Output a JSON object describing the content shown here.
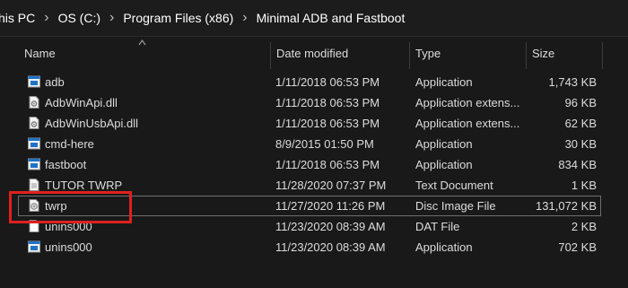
{
  "breadcrumb": [
    "his PC",
    "OS (C:)",
    "Program Files (x86)",
    "Minimal ADB and Fastboot"
  ],
  "columns": {
    "name": "Name",
    "date": "Date modified",
    "type": "Type",
    "size": "Size"
  },
  "files": [
    {
      "name": "adb",
      "date": "1/11/2018 06:53 PM",
      "type": "Application",
      "size": "1,743 KB",
      "icon": "application-icon"
    },
    {
      "name": "AdbWinApi.dll",
      "date": "1/11/2018 06:53 PM",
      "type": "Application extens...",
      "size": "96 KB",
      "icon": "dll-icon"
    },
    {
      "name": "AdbWinUsbApi.dll",
      "date": "1/11/2018 06:53 PM",
      "type": "Application extens...",
      "size": "62 KB",
      "icon": "dll-icon"
    },
    {
      "name": "cmd-here",
      "date": "8/9/2015 01:50 PM",
      "type": "Application",
      "size": "30 KB",
      "icon": "application-icon"
    },
    {
      "name": "fastboot",
      "date": "1/11/2018 06:53 PM",
      "type": "Application",
      "size": "834 KB",
      "icon": "application-icon"
    },
    {
      "name": "TUTOR TWRP",
      "date": "11/28/2020 07:37 PM",
      "type": "Text Document",
      "size": "1 KB",
      "icon": "text-document-icon"
    },
    {
      "name": "twrp",
      "date": "11/27/2020 11:26 PM",
      "type": "Disc Image File",
      "size": "131,072 KB",
      "icon": "disc-image-icon"
    },
    {
      "name": "unins000",
      "date": "11/23/2020 08:39 AM",
      "type": "DAT File",
      "size": "2 KB",
      "icon": "dat-file-icon"
    },
    {
      "name": "unins000",
      "date": "11/23/2020 08:39 AM",
      "type": "Application",
      "size": "702 KB",
      "icon": "application-icon"
    }
  ],
  "colors": {
    "background": "#191919",
    "highlight": "#e02020",
    "app_icon_blue": "#1e73c8"
  }
}
